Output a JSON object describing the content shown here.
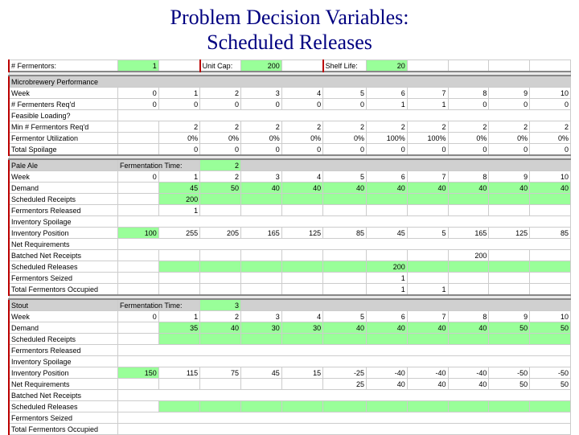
{
  "title_line1": "Problem Decision Variables:",
  "title_line2": "Scheduled Releases",
  "top": {
    "fermentors_lbl": "# Fermentors:",
    "fermentors_val": "1",
    "unitcap_lbl": "Unit Cap:",
    "unitcap_val": "200",
    "shelflife_lbl": "Shelf Life:",
    "shelflife_val": "20"
  },
  "perf": {
    "header": "Microbrewery Performance",
    "week_lbl": "Week",
    "weeks": [
      "0",
      "1",
      "2",
      "3",
      "4",
      "5",
      "6",
      "7",
      "8",
      "9",
      "10"
    ],
    "fermreq_lbl": "# Fermenters Req'd",
    "fermreq": [
      "0",
      "0",
      "0",
      "0",
      "0",
      "0",
      "1",
      "1",
      "0",
      "0",
      "0"
    ],
    "feas_lbl": "Feasible Loading?",
    "minf_lbl": "Min # Fermentors Req'd",
    "minf": [
      "",
      "2",
      "2",
      "2",
      "2",
      "2",
      "2",
      "2",
      "2",
      "2",
      "2"
    ],
    "util_lbl": "Fermentor Utilization",
    "util": [
      "",
      "0%",
      "0%",
      "0%",
      "0%",
      "0%",
      "100%",
      "100%",
      "0%",
      "0%",
      "0%"
    ],
    "spoil_lbl": "Total Spoilage",
    "spoil": [
      "",
      "0",
      "0",
      "0",
      "0",
      "0",
      "0",
      "0",
      "0",
      "0",
      "0"
    ]
  },
  "pale": {
    "header": "Pale Ale",
    "ftime_lbl": "Fermentation Time:",
    "ftime_val": "2",
    "week_lbl": "Week",
    "weeks": [
      "0",
      "1",
      "2",
      "3",
      "4",
      "5",
      "6",
      "7",
      "8",
      "9",
      "10"
    ],
    "demand_lbl": "Demand",
    "demand": [
      "",
      "45",
      "50",
      "40",
      "40",
      "40",
      "40",
      "40",
      "40",
      "40",
      "40"
    ],
    "schrec_lbl": "Scheduled Receipts",
    "schrec": [
      "",
      "200",
      "",
      "",
      "",
      "",
      "",
      "",
      "",
      "",
      ""
    ],
    "frel_lbl": "Fermentors Released",
    "frel": [
      "",
      "1",
      "",
      "",
      "",
      "",
      "",
      "",
      "",
      "",
      ""
    ],
    "invsp_lbl": "Inventory Spoilage",
    "invpos_lbl": "Inventory Position",
    "invpos": [
      "100",
      "255",
      "205",
      "165",
      "125",
      "85",
      "45",
      "5",
      "165",
      "125",
      "85"
    ],
    "netreq_lbl": "Net Requirements",
    "batnet_lbl": "Batched Net Receipts",
    "batnet": [
      "",
      "",
      "",
      "",
      "",
      "",
      "",
      "",
      "200",
      "",
      ""
    ],
    "schrel_lbl": "Scheduled Releases",
    "schrel": [
      "",
      "",
      "",
      "",
      "",
      "",
      "200",
      "",
      "",
      "",
      ""
    ],
    "fseiz_lbl": "Fermentors Seized",
    "fseiz": [
      "",
      "",
      "",
      "",
      "",
      "",
      "1",
      "",
      "",
      "",
      ""
    ],
    "tfocc_lbl": "Total Fermentors Occupied",
    "tfocc": [
      "",
      "",
      "",
      "",
      "",
      "",
      "1",
      "1",
      "",
      "",
      ""
    ]
  },
  "stout": {
    "header": "Stout",
    "ftime_lbl": "Fermentation Time:",
    "ftime_val": "3",
    "week_lbl": "Week",
    "weeks": [
      "0",
      "1",
      "2",
      "3",
      "4",
      "5",
      "6",
      "7",
      "8",
      "9",
      "10"
    ],
    "demand_lbl": "Demand",
    "demand": [
      "",
      "35",
      "40",
      "30",
      "30",
      "40",
      "40",
      "40",
      "40",
      "50",
      "50"
    ],
    "schrec_lbl": "Scheduled Receipts",
    "frel_lbl": "Fermentors Released",
    "invsp_lbl": "Inventory Spoilage",
    "invpos_lbl": "Inventory Position",
    "invpos": [
      "150",
      "115",
      "75",
      "45",
      "15",
      "-25",
      "-40",
      "-40",
      "-40",
      "-50",
      "-50"
    ],
    "netreq_lbl": "Net Requirements",
    "netreq": [
      "",
      "",
      "",
      "",
      "",
      "25",
      "40",
      "40",
      "40",
      "50",
      "50"
    ],
    "batnet_lbl": "Batched Net Receipts",
    "schrel_lbl": "Scheduled Releases",
    "fseiz_lbl": "Fermentors Seized",
    "tfocc_lbl": "Total Fermentors Occupied"
  }
}
